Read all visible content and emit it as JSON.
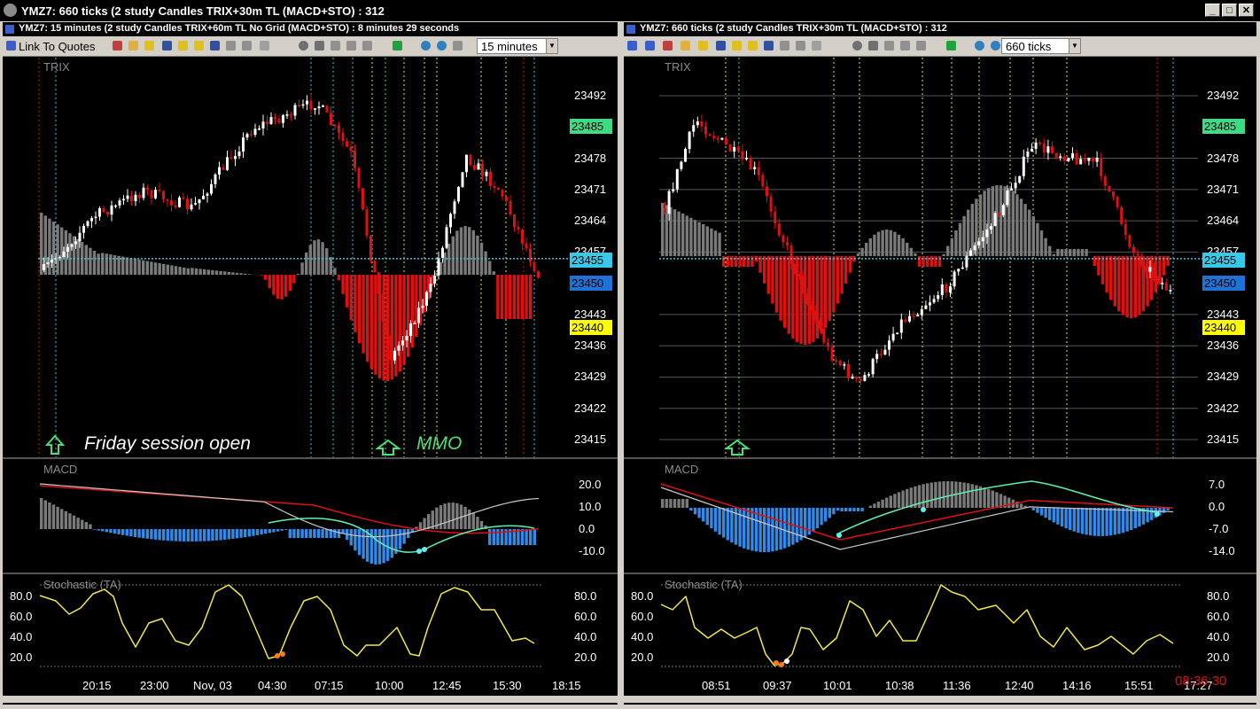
{
  "window": {
    "title": "YMZ7: 660 ticks (2 study Candles TRIX+30m TL  (MACD+STO) : 312",
    "min": "_",
    "max": "□",
    "close": "✕"
  },
  "left": {
    "chart_title": "YMZ7: 15 minutes (2 study Candles TRIX+60m TL No Grid (MACD+STO) : 8 minutes 29 seconds",
    "toolbar": {
      "link_label": "Link To Quotes",
      "interval": "15 minutes"
    },
    "main": {
      "study_label": "TRIX",
      "prices": [
        "23492",
        "23478",
        "23471",
        "23464",
        "23457",
        "23443",
        "23436",
        "23429",
        "23422",
        "23415"
      ],
      "badges": [
        {
          "value": "23485",
          "color": "#3ddc84"
        },
        {
          "value": "23455",
          "color": "#39c9e8"
        },
        {
          "value": "23450",
          "color": "#1e73d6"
        },
        {
          "value": "23440",
          "color": "#ffff00"
        }
      ],
      "annotations": {
        "session": "Friday session open",
        "mmo": "MMO"
      }
    },
    "macd": {
      "label": "MACD",
      "levels": [
        "20.0",
        "10.0",
        "0.0",
        "-10.0"
      ]
    },
    "sto": {
      "label": "Stochastic (TA)",
      "levels_left": [
        "80.0",
        "60.0",
        "40.0",
        "20.0"
      ],
      "levels_right": [
        "80.0",
        "60.0",
        "40.0",
        "20.0"
      ]
    },
    "time_axis": [
      "20:15",
      "23:00",
      "Nov, 03",
      "04:30",
      "07:15",
      "10:00",
      "12:45",
      "15:30",
      "18:15"
    ]
  },
  "right": {
    "chart_title": "YMZ7: 660 ticks (2 study Candles TRIX+30m TL  (MACD+STO) : 312",
    "toolbar": {
      "interval": "660 ticks"
    },
    "main": {
      "study_label": "TRIX",
      "prices": [
        "23492",
        "23478",
        "23471",
        "23464",
        "23457",
        "23443",
        "23436",
        "23429",
        "23422",
        "23415"
      ],
      "badges": [
        {
          "value": "23485",
          "color": "#3ddc84"
        },
        {
          "value": "23455",
          "color": "#39c9e8"
        },
        {
          "value": "23450",
          "color": "#1e73d6"
        },
        {
          "value": "23440",
          "color": "#ffff00"
        }
      ]
    },
    "macd": {
      "label": "MACD",
      "levels": [
        "7.0",
        "0.0",
        "-7.0",
        "-14.0"
      ]
    },
    "sto": {
      "label": "Stochastic (TA)",
      "levels_left": [
        "80.0",
        "60.0",
        "40.0",
        "20.0"
      ],
      "levels_right": [
        "80.0",
        "60.0",
        "40.0",
        "20.0"
      ]
    },
    "time_axis": [
      "08:51",
      "09:37",
      "10:01",
      "10:38",
      "11:36",
      "12:40",
      "14:16",
      "15:51",
      "17:27"
    ],
    "clock": "08:36:30"
  }
}
